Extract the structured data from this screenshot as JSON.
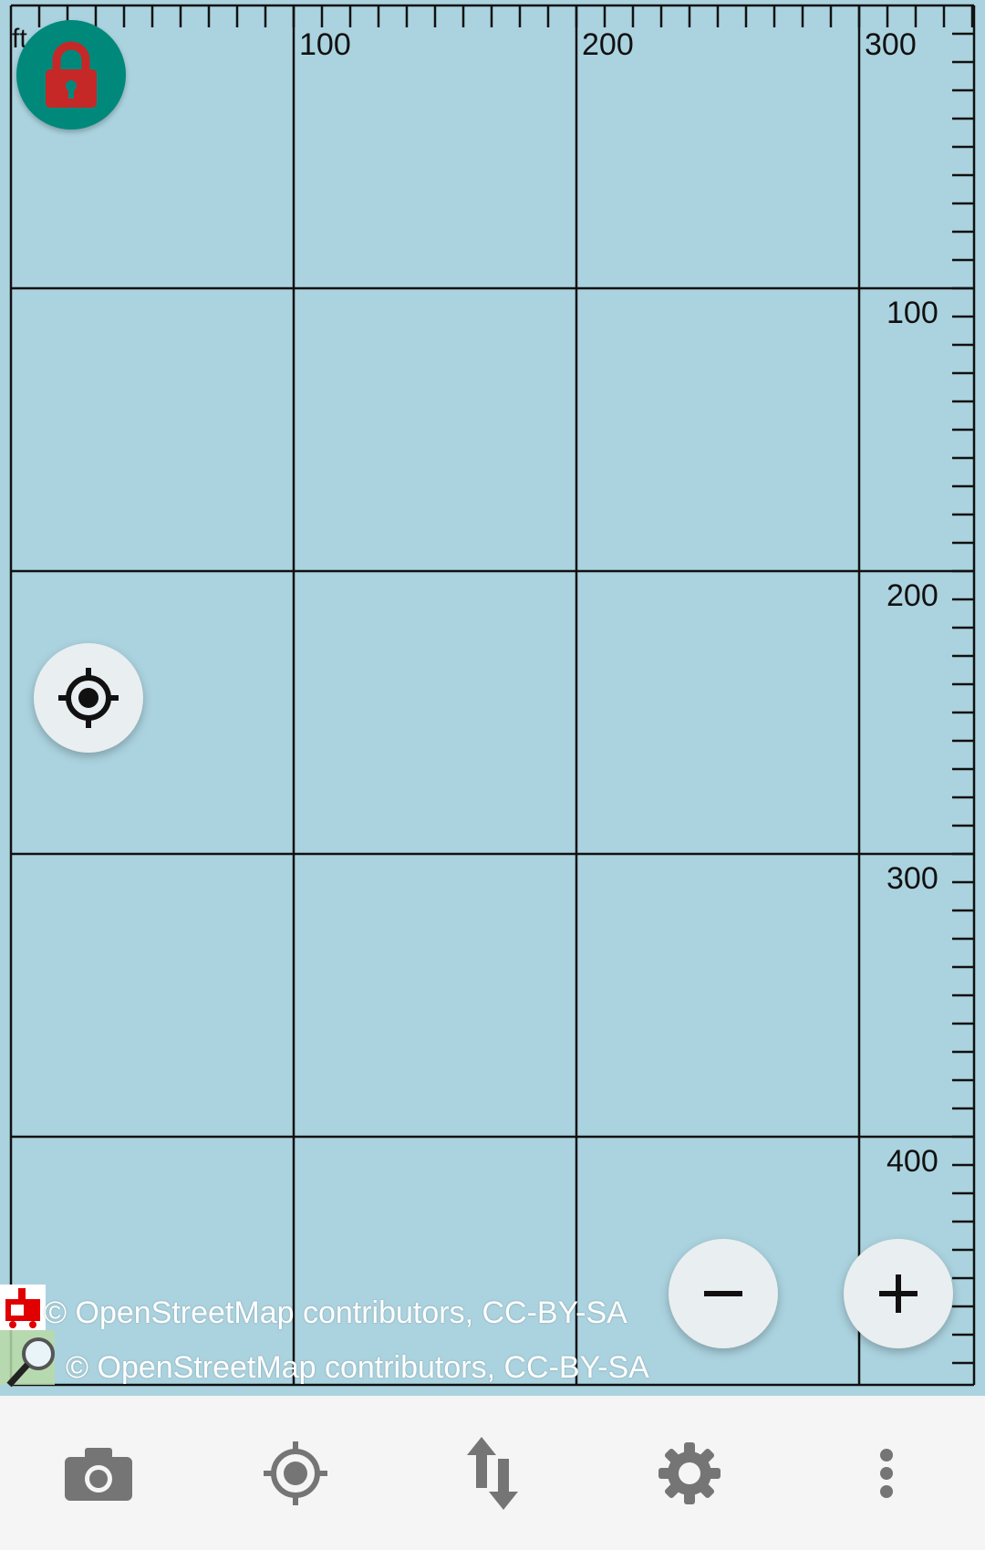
{
  "map": {
    "background_color": "#abd3df",
    "unit_label": "ft",
    "top_scale_labels": [
      "100",
      "200",
      "300"
    ],
    "right_scale_labels": [
      "100",
      "200",
      "300",
      "400"
    ],
    "attributions": [
      "© OpenStreetMap contributors, CC-BY-SA",
      "© OpenStreetMap contributors, CC-BY-SA"
    ]
  },
  "controls": {
    "lock_icon": "lock-icon",
    "lock_button_color": "#00897b",
    "lock_icon_color": "#c62828",
    "locate_icon": "my-location-icon",
    "zoom_out_icon": "minus-icon",
    "zoom_in_icon": "plus-icon"
  },
  "bottom_bar": {
    "items": [
      {
        "icon": "camera-icon"
      },
      {
        "icon": "gps-icon"
      },
      {
        "icon": "transfer-arrows-icon"
      },
      {
        "icon": "gear-icon"
      },
      {
        "icon": "more-vertical-icon"
      }
    ],
    "icon_color": "#757575"
  }
}
